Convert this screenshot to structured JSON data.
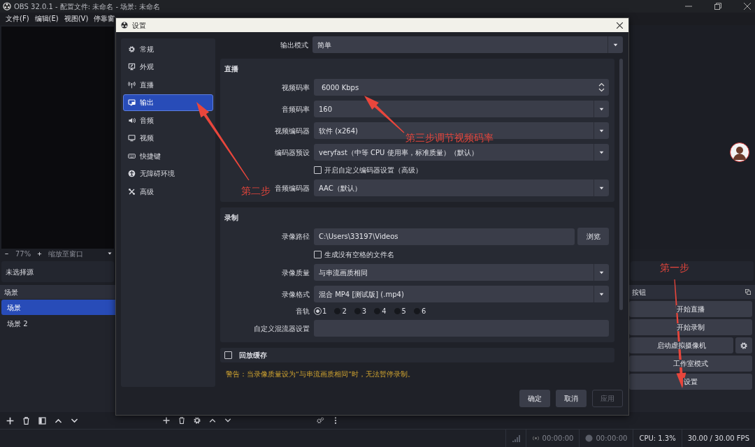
{
  "window": {
    "title": "OBS 32.0.1 - 配置文件: 未命名 - 场景: 未命名"
  },
  "menu": [
    {
      "label": "文件(F)"
    },
    {
      "label": "编辑(E)"
    },
    {
      "label": "视图(V)"
    },
    {
      "label": "停靠窗"
    }
  ],
  "zoom_bar": {
    "zoom": "77%",
    "mode": "缩放至窗口"
  },
  "source_info": "未选择源",
  "scenes": {
    "title": "场景",
    "items": [
      {
        "label": "场景",
        "selected": true
      },
      {
        "label": "场景 2",
        "selected": false
      }
    ]
  },
  "controls": {
    "title": "按钮",
    "buttons": [
      {
        "label": "开始直播",
        "has_settings": false
      },
      {
        "label": "开始录制",
        "has_settings": false
      },
      {
        "label": "启动虚拟摄像机",
        "has_settings": true
      },
      {
        "label": "工作室模式",
        "has_settings": false
      },
      {
        "label": "设置",
        "has_settings": false
      }
    ]
  },
  "settings_dialog": {
    "title": "设置",
    "sidebar": [
      {
        "label": "常规",
        "selected": false
      },
      {
        "label": "外观",
        "selected": false
      },
      {
        "label": "直播",
        "selected": false
      },
      {
        "label": "输出",
        "selected": true
      },
      {
        "label": "音频",
        "selected": false
      },
      {
        "label": "视频",
        "selected": false
      },
      {
        "label": "快捷键",
        "selected": false
      },
      {
        "label": "无障碍环境",
        "selected": false
      },
      {
        "label": "高级",
        "selected": false
      }
    ],
    "output_mode": {
      "label": "输出模式",
      "value": "简单"
    },
    "sections": [
      {
        "title": "直播",
        "rows": [
          {
            "kind": "spin",
            "label": "视频码率",
            "value": "6000 Kbps"
          },
          {
            "kind": "select",
            "label": "音频码率",
            "value": "160"
          },
          {
            "kind": "select",
            "label": "视频编码器",
            "value": "软件 (x264)"
          },
          {
            "kind": "select",
            "label": "编码器预设",
            "value": "veryfast（中等 CPU 使用率，标准质量）（默认）"
          },
          {
            "kind": "checkbox",
            "label": "开启自定义编码器设置（高级）",
            "checked": false
          },
          {
            "kind": "select",
            "label": "音频编码器",
            "value": "AAC（默认）"
          }
        ]
      },
      {
        "title": "录制",
        "rows": [
          {
            "kind": "path",
            "label": "录像路径",
            "value": "C:\\Users\\33197\\Videos",
            "button": "浏览"
          },
          {
            "kind": "checkbox",
            "label": "生成没有空格的文件名",
            "checked": false
          },
          {
            "kind": "select",
            "label": "录像质量",
            "value": "与串流画质相同"
          },
          {
            "kind": "select",
            "label": "录像格式",
            "value": "混合 MP4 [测试版] (.mp4)"
          },
          {
            "kind": "tracks",
            "label": "音轨",
            "tracks": [
              {
                "label": "1",
                "selected": true
              },
              {
                "label": "2",
                "selected": false
              },
              {
                "label": "3",
                "selected": false
              },
              {
                "label": "4",
                "selected": false
              },
              {
                "label": "5",
                "selected": false
              },
              {
                "label": "6",
                "selected": false
              }
            ]
          },
          {
            "kind": "text",
            "label": "自定义混流器设置"
          }
        ]
      }
    ],
    "replay_buffer": {
      "label": "回放缓存",
      "checked": false
    },
    "warning": "警告：当录像质量设为“与串流画质相同”时，无法暂停录制。",
    "buttons": [
      {
        "label": "确定",
        "disabled": false
      },
      {
        "label": "取消",
        "disabled": false
      },
      {
        "label": "应用",
        "disabled": true
      }
    ]
  },
  "status_bar": {
    "stream_time": "00:00:00",
    "record_time": "00:00:00",
    "cpu": "CPU: 1.3%",
    "fps": "30.00 / 30.00 FPS"
  },
  "annotations": [
    {
      "text": "第三步调节视频码率"
    },
    {
      "text": "第二步"
    },
    {
      "text": "第一步"
    }
  ]
}
